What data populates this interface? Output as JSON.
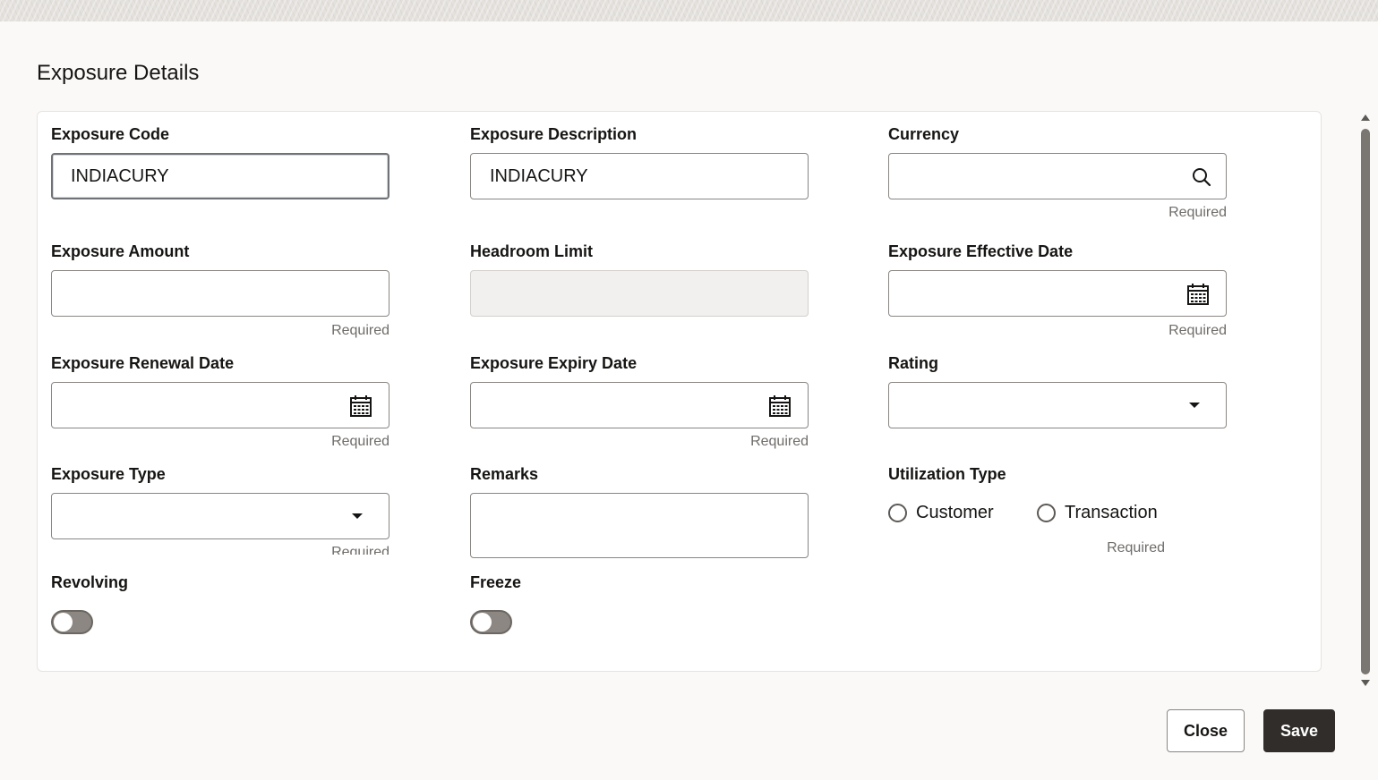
{
  "dialog": {
    "title": "Exposure Details",
    "close_label": "Close",
    "save_label": "Save"
  },
  "fields": {
    "exposure_code": {
      "label": "Exposure Code",
      "value": "INDIACURY"
    },
    "exposure_description": {
      "label": "Exposure Description",
      "value": "INDIACURY"
    },
    "currency": {
      "label": "Currency",
      "value": "",
      "hint": "Required",
      "icon": "search-icon"
    },
    "exposure_amount": {
      "label": "Exposure Amount",
      "value": "",
      "hint": "Required"
    },
    "headroom_limit": {
      "label": "Headroom Limit",
      "value": ""
    },
    "exposure_effective_date": {
      "label": "Exposure Effective Date",
      "value": "",
      "hint": "Required",
      "icon": "calendar-icon"
    },
    "exposure_renewal_date": {
      "label": "Exposure Renewal Date",
      "value": "",
      "hint": "Required",
      "icon": "calendar-icon"
    },
    "exposure_expiry_date": {
      "label": "Exposure Expiry Date",
      "value": "",
      "hint": "Required",
      "icon": "calendar-icon"
    },
    "rating": {
      "label": "Rating",
      "value": "",
      "icon": "chevron-down-icon"
    },
    "exposure_type": {
      "label": "Exposure Type",
      "value": "",
      "hint": "Required",
      "icon": "chevron-down-icon"
    },
    "remarks": {
      "label": "Remarks",
      "value": ""
    },
    "utilization_type": {
      "label": "Utilization Type",
      "options": [
        "Customer",
        "Transaction"
      ],
      "hint": "Required"
    },
    "revolving": {
      "label": "Revolving",
      "on": false
    },
    "freeze": {
      "label": "Freeze",
      "on": false
    }
  },
  "colors": {
    "primary_button": "#312d2a",
    "text": "#161513",
    "hint": "#6f6c69",
    "toggle_off": "#8c8782"
  }
}
